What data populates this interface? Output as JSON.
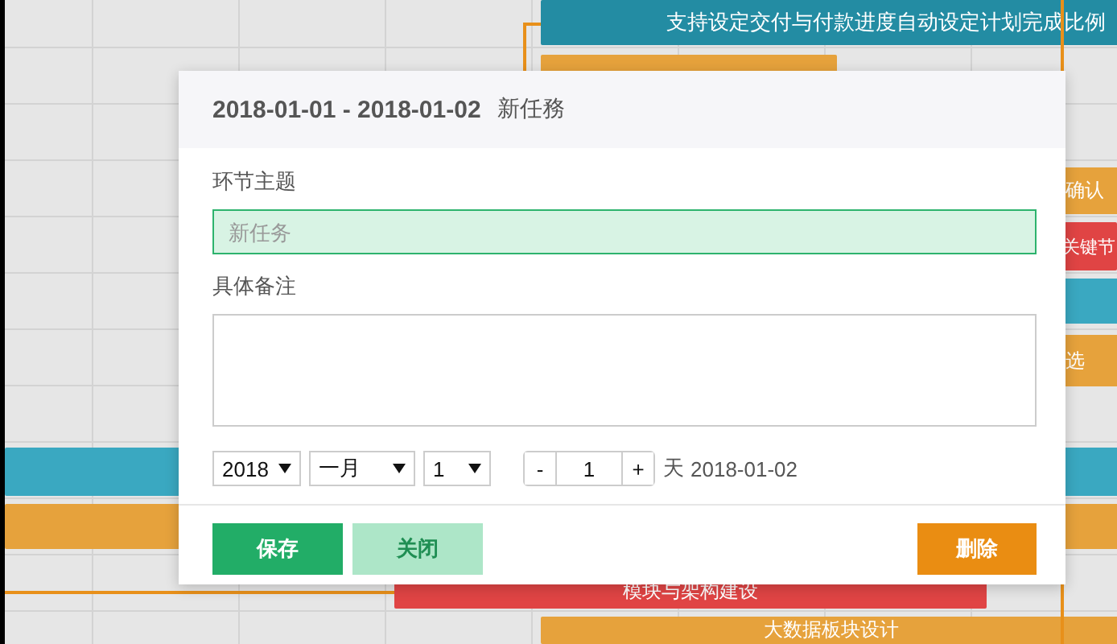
{
  "gantt": {
    "bars": [
      {
        "text": "支持设定交付与付款进度自动设定计划完成比例",
        "color": "#238ca3"
      },
      {
        "color": "#e6a23c"
      },
      {
        "text": "确认",
        "color": "#e6a23c"
      },
      {
        "text": "关键节",
        "color": "#e04444"
      },
      {
        "color": "#3aa8c1"
      },
      {
        "text": "选",
        "color": "#e6a23c"
      },
      {
        "color": "#3aa8c1"
      },
      {
        "color": "#e6a23c"
      },
      {
        "text": "模块与架构建设",
        "color": "#e04444"
      },
      {
        "text": "大数据板块设计",
        "color": "#e6a23c"
      }
    ]
  },
  "dialog": {
    "date_range": "2018-01-01 - 2018-01-02",
    "title": "新任務",
    "fields": [
      {
        "label": "环节主题",
        "kind": "input",
        "placeholder": "新任务"
      },
      {
        "label": "具体备注",
        "kind": "textarea"
      }
    ],
    "year": "2018",
    "month": "一月",
    "day": "1",
    "stepper": {
      "minus": "-",
      "value": "1",
      "plus": "+"
    },
    "unit": "天",
    "end_date": "2018-01-02",
    "buttons": [
      {
        "label": "保存",
        "kind": "primary"
      },
      {
        "label": "关闭",
        "kind": "secondary"
      },
      {
        "label": "删除",
        "kind": "danger"
      }
    ]
  }
}
